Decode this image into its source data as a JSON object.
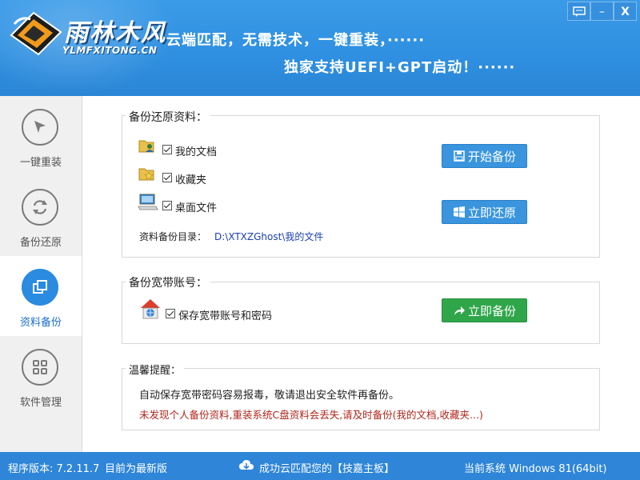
{
  "header": {
    "logo_title": "雨林木风",
    "logo_sub": "YLMFXITONG.CN",
    "slogan_line1": "云端匹配，无需技术，一键重装，······",
    "slogan_line2": "独家支持UEFI+GPT启动！······",
    "window_buttons": {
      "chat": "chat-icon",
      "minimize": "–",
      "close": "X"
    }
  },
  "sidebar": {
    "items": [
      {
        "label": "一键重装",
        "icon": "cursor-arrow-icon",
        "active": false
      },
      {
        "label": "备份还原",
        "icon": "refresh-icon",
        "active": false
      },
      {
        "label": "资料备份",
        "icon": "copy-icon",
        "active": true
      },
      {
        "label": "软件管理",
        "icon": "grid-icon",
        "active": false
      }
    ]
  },
  "backup_panel": {
    "title": "备份还原资料：",
    "items": [
      {
        "label": "我的文档",
        "checked": true,
        "icon": "user-folder-icon"
      },
      {
        "label": "收藏夹",
        "checked": true,
        "icon": "folder-star-icon"
      },
      {
        "label": "桌面文件",
        "checked": true,
        "icon": "desktop-icon"
      }
    ],
    "dir_label": "资料备份目录：",
    "dir_value": "D:\\XTXZGhost\\我的文件",
    "start_backup": "开始备份",
    "restore_now": "立即还原"
  },
  "broadband_panel": {
    "title": "备份宽带账号：",
    "item_label": "保存宽带账号和密码",
    "checked": true,
    "backup_now": "立即备份"
  },
  "tips_panel": {
    "title": "温馨提醒：",
    "line1": "自动保存宽带密码容易报毒，敬请退出安全软件再备份。",
    "line2": "未发现个人备份资料,重装系统C盘资料会丢失,请及时备份(我的文档,收藏夹...)"
  },
  "statusbar": {
    "version": "程序版本: 7.2.11.7",
    "version_status": "目前为最新版",
    "cloud_match": "成功云匹配您的【技嘉主板】",
    "system": "当前系统 Windows 81(64bit)"
  },
  "colors": {
    "header_blue": "#2f8fe0",
    "status_blue": "#2f86d8",
    "button_blue": "#3a95de",
    "button_green": "#2fa64a",
    "warn_red": "#b0261c",
    "link_blue": "#1a3fb0"
  }
}
